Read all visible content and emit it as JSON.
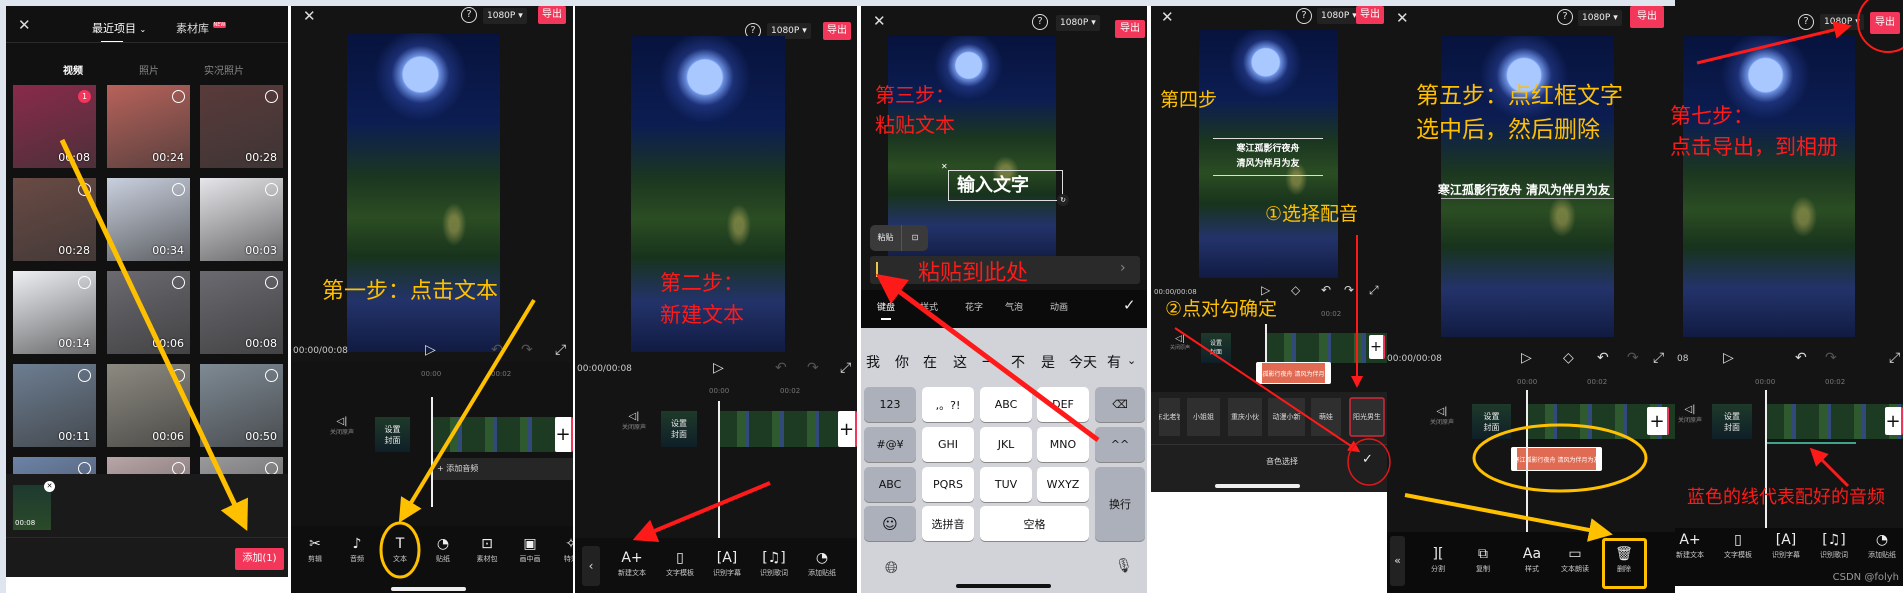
{
  "colors": {
    "accent": "#f2375a",
    "annotation_yellow": "#ffc000",
    "annotation_red": "#ff1a1a",
    "text_clip": "#e06a52",
    "audio_line": "#3fa38a"
  },
  "panel1": {
    "header": {
      "recent": "最近项目",
      "library": "素材库",
      "new_badge": "NEW"
    },
    "media_tabs": [
      "视频",
      "照片",
      "实况照片"
    ],
    "thumbnails": [
      {
        "duration": "00:08",
        "color": "#8a2a4a",
        "selected": "1"
      },
      {
        "duration": "00:24",
        "color": "#b8625a"
      },
      {
        "duration": "00:28",
        "color": "#5a3a3a"
      },
      {
        "duration": "00:28",
        "color": "#6a4a44"
      },
      {
        "duration": "00:34",
        "color": "#c9d0de"
      },
      {
        "duration": "00:03",
        "color": "#e6e6ea"
      },
      {
        "duration": "00:14",
        "color": "#eef0f4"
      },
      {
        "duration": "00:06",
        "color": "#6a6a70"
      },
      {
        "duration": "00:08",
        "color": "#6a6a70"
      },
      {
        "duration": "00:11",
        "color": "#6d7e92"
      },
      {
        "duration": "00:06",
        "color": "#8c8a80"
      },
      {
        "duration": "00:50",
        "color": "#7e8a94"
      },
      {
        "duration": "",
        "color": "#6c83a8"
      },
      {
        "duration": "",
        "color": "#b9a6a8"
      },
      {
        "duration": "",
        "color": "#9a9a9c"
      }
    ],
    "selection": {
      "duration": "00:08"
    },
    "add_button": "添加(1)"
  },
  "editor": {
    "resolution": "1080P",
    "export": "导出",
    "time": "00:00/00:08",
    "ruler": [
      "00:00",
      "00:02"
    ],
    "mute": "关闭原声",
    "cover": [
      "设置",
      "封面"
    ],
    "add_audio": "添加音频"
  },
  "panel2": {
    "annotation": "第一步：点击文本",
    "toolbar": [
      "剪辑",
      "音频",
      "文本",
      "贴纸",
      "素材包",
      "画中画",
      "特效"
    ]
  },
  "panel3": {
    "annotation": [
      "第二步：",
      "新建文本"
    ],
    "toolbar": [
      "新建文本",
      "文字模板",
      "识别字幕",
      "识别歌词",
      "添加贴纸"
    ]
  },
  "panel4": {
    "annotation": [
      "第三步：",
      "粘贴文本"
    ],
    "textbox": "输入文字",
    "paste": "粘贴",
    "input_hint": "粘贴到此处",
    "tabs": [
      "键盘",
      "样式",
      "花字",
      "气泡",
      "动画"
    ],
    "candidates": [
      "我",
      "你",
      "在",
      "这",
      "一",
      "不",
      "是",
      "今天",
      "有"
    ],
    "keys": {
      "row1": [
        "123",
        ",。?!",
        "ABC",
        "DEF"
      ],
      "row2": [
        "#@¥",
        "GHI",
        "JKL",
        "MNO",
        "^^"
      ],
      "row3": [
        "ABC",
        "PQRS",
        "TUV",
        "WXYZ"
      ],
      "row4": [
        "选拼音",
        "空格"
      ],
      "enter": "换行"
    }
  },
  "panel5": {
    "annotation": "第四步",
    "step1": "①选择配音",
    "step2": "②点对勾确定",
    "subtitle": [
      "寒江孤影行夜舟",
      "清风为伴月为友"
    ],
    "clip_text": "寒江孤影行夜舟 清风为伴月为友",
    "voices": [
      "东北老铁",
      "小姐姐",
      "重庆小伙",
      "动漫小新",
      "萌娃",
      "阳光男生"
    ],
    "voice_label": "音色选择"
  },
  "panel6": {
    "annotation": [
      "第五步：点红框文字",
      "选中后，然后删除"
    ],
    "subtitle": "寒江孤影行夜舟 清风为伴月为友",
    "toolbar": [
      "分割",
      "复制",
      "样式",
      "文本朗读",
      "删除"
    ]
  },
  "panel7": {
    "annotation": [
      "第七步：",
      "点击导出，到相册"
    ],
    "audio_note": "蓝色的线代表配好的音频",
    "time_partial": "08",
    "toolbar": [
      "新建文本",
      "文字模板",
      "识别字幕",
      "识别歌词",
      "添加贴纸"
    ]
  },
  "watermark": "CSDN @folyh"
}
